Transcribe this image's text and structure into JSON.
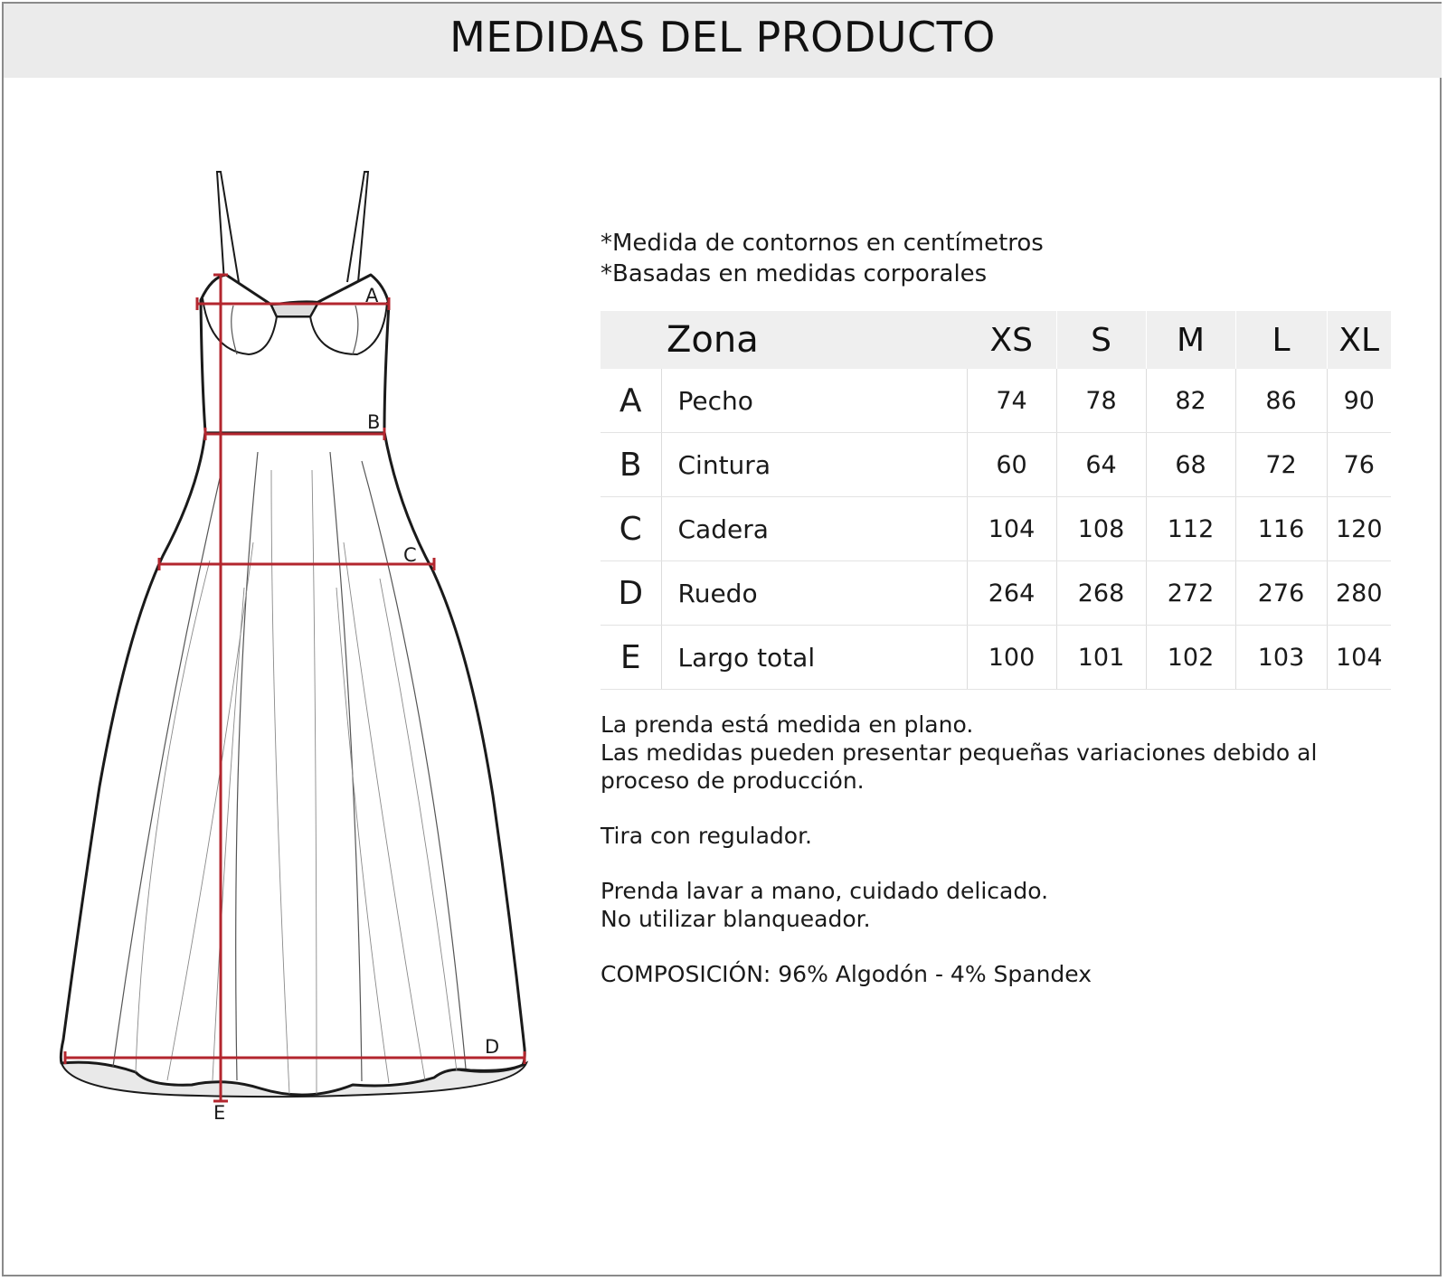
{
  "title": "MEDIDAS DEL PRODUCTO",
  "notes": [
    "*Medida de contornos en centímetros",
    "*Basadas en medidas corporales"
  ],
  "table": {
    "zone_header": "Zona",
    "sizes": [
      "XS",
      "S",
      "M",
      "L",
      "XL"
    ],
    "rows": [
      {
        "letter": "A",
        "zone": "Pecho",
        "values": [
          "74",
          "78",
          "82",
          "86",
          "90"
        ]
      },
      {
        "letter": "B",
        "zone": "Cintura",
        "values": [
          "60",
          "64",
          "68",
          "72",
          "76"
        ]
      },
      {
        "letter": "C",
        "zone": "Cadera",
        "values": [
          "104",
          "108",
          "112",
          "116",
          "120"
        ]
      },
      {
        "letter": "D",
        "zone": "Ruedo",
        "values": [
          "264",
          "268",
          "272",
          "276",
          "280"
        ]
      },
      {
        "letter": "E",
        "zone": "Largo total",
        "values": [
          "100",
          "101",
          "102",
          "103",
          "104"
        ]
      }
    ]
  },
  "info": {
    "measure": [
      "La prenda está medida en plano.",
      "Las medidas pueden presentar pequeñas variaciones debido al",
      "proceso de producción."
    ],
    "strap": [
      "Tira con regulador."
    ],
    "care": [
      "Prenda lavar a mano, cuidado delicado.",
      "No utilizar blanqueador."
    ],
    "composition": [
      "COMPOSICIÓN: 96% Algodón - 4% Spandex"
    ]
  },
  "diagram": {
    "labels": {
      "a": "A",
      "b": "B",
      "c": "C",
      "d": "D",
      "e": "E"
    },
    "measure_color": "#b3262e",
    "outline_color": "#1a1a1a"
  }
}
